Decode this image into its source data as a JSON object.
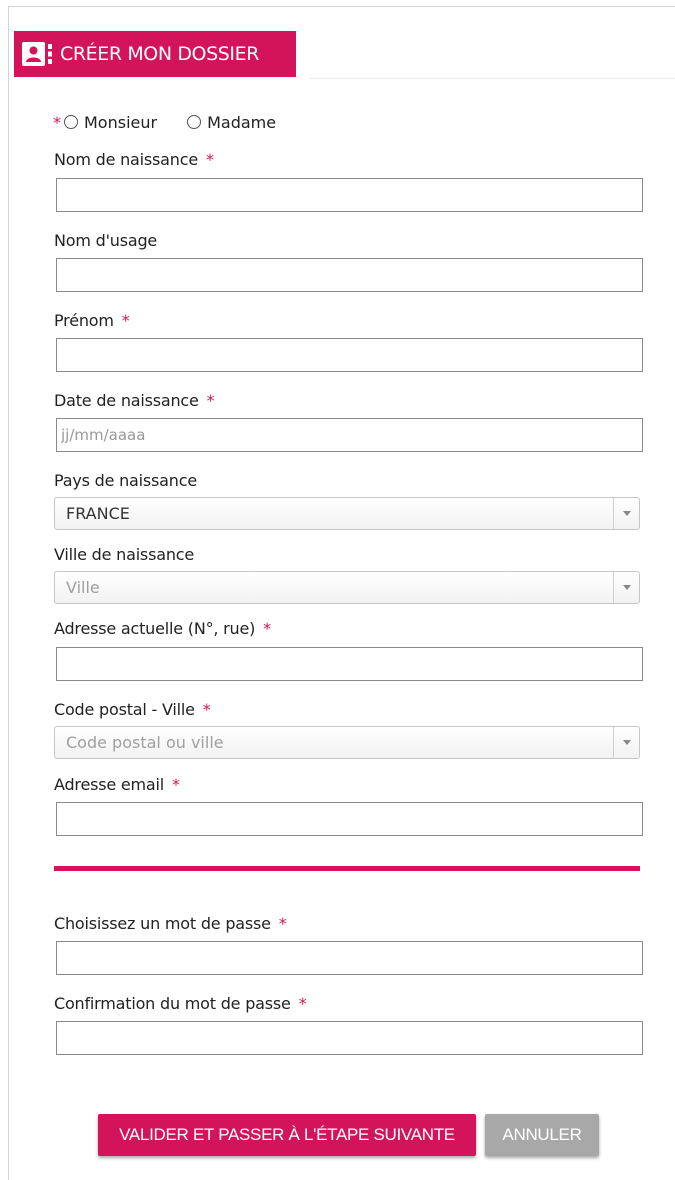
{
  "header": {
    "title": "CRÉER MON DOSSIER",
    "icon": "contact-card-icon",
    "color": "#d4145a"
  },
  "gender": {
    "required_mark": "*",
    "options": [
      "Monsieur",
      "Madame"
    ]
  },
  "fields": {
    "birth_name": {
      "label": "Nom de naissance",
      "required_mark": "*",
      "value": ""
    },
    "usage_name": {
      "label": "Nom d'usage",
      "value": ""
    },
    "first_name": {
      "label": "Prénom",
      "required_mark": "*",
      "value": ""
    },
    "birth_date": {
      "label": "Date de naissance",
      "required_mark": "*",
      "placeholder": "jj/mm/aaaa"
    },
    "birth_country": {
      "label": "Pays de naissance",
      "value": "FRANCE"
    },
    "birth_city": {
      "label": "Ville de naissance",
      "placeholder": "Ville"
    },
    "address": {
      "label": "Adresse actuelle (N°, rue)",
      "required_mark": "*",
      "value": ""
    },
    "postal_city": {
      "label": "Code postal - Ville",
      "required_mark": "*",
      "placeholder": "Code postal ou ville"
    },
    "email": {
      "label": "Adresse email",
      "required_mark": "*",
      "value": ""
    },
    "password": {
      "label": "Choisissez un mot de passe",
      "required_mark": "*",
      "value": ""
    },
    "password_confirm": {
      "label": "Confirmation du mot de passe",
      "required_mark": "*",
      "value": ""
    }
  },
  "buttons": {
    "submit": "VALIDER ET PASSER À L'ÉTAPE SUIVANTE",
    "cancel": "ANNULER"
  },
  "colors": {
    "accent": "#d4145a",
    "cancel": "#a8a8a8"
  }
}
